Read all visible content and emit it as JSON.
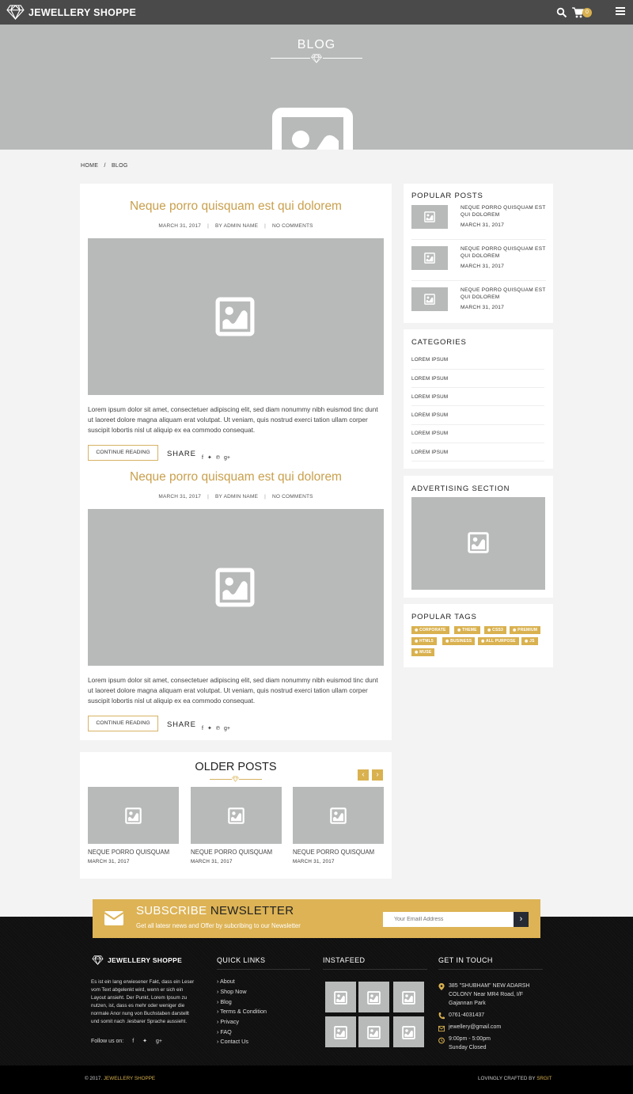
{
  "header": {
    "brand": "JEWELLERY SHOPPE",
    "cart_count": "0",
    "icons": [
      "diamond-icon",
      "search-icon",
      "cart-icon",
      "menu-icon"
    ]
  },
  "hero": {
    "title": "BLOG"
  },
  "breadcrumb": {
    "home": "HOME",
    "sep": "/",
    "current": "BLOG"
  },
  "posts": [
    {
      "title": "Neque porro quisquam est qui dolorem",
      "date": "MARCH 31, 2017",
      "author": "BY ADMIN NAME",
      "comments": "NO COMMENTS",
      "excerpt": "Lorem ipsum dolor sit amet, consectetuer adipiscing elit, sed diam nonummy nibh euismod tinc dunt ut laoreet dolore magna aliquam erat volutpat. Ut veniam, quis nostrud exerci tation ullam corper suscipit lobortis nisl ut aliquip ex ea commodo consequat.",
      "button": "CONTINUE READING",
      "share": "SHARE"
    },
    {
      "title": "Neque porro quisquam est qui dolorem",
      "date": "MARCH 31, 2017",
      "author": "BY ADMIN NAME",
      "comments": "NO COMMENTS",
      "excerpt": "Lorem ipsum dolor sit amet, consectetuer adipiscing elit, sed diam nonummy nibh euismod tinc dunt ut laoreet dolore magna aliquam erat volutpat. Ut veniam, quis nostrud exerci tation ullam corper suscipit lobortis nisl ut aliquip ex ea commodo consequat.",
      "button": "CONTINUE READING",
      "share": "SHARE"
    }
  ],
  "share_icons": {
    "facebook": "f",
    "twitter": "✦",
    "pinterest": "℗",
    "gplus": "g+"
  },
  "older": {
    "title": "OLDER POSTS",
    "prev": "‹",
    "next": "›",
    "items": [
      {
        "name": "NEQUE PORRO QUISQUAM",
        "date": "MARCH 31, 2017"
      },
      {
        "name": "NEQUE PORRO QUISQUAM",
        "date": "MARCH 31, 2017"
      },
      {
        "name": "NEQUE PORRO QUISQUAM",
        "date": "MARCH 31, 2017"
      }
    ]
  },
  "sidebar": {
    "popular_title": "POPULAR POSTS",
    "popular": [
      {
        "name": "NEQUE PORRO QUISQUAM EST QUI DOLOREM",
        "date": "MARCH 31, 2017"
      },
      {
        "name": "NEQUE PORRO QUISQUAM EST QUI DOLOREM",
        "date": "MARCH 31, 2017"
      },
      {
        "name": "NEQUE PORRO QUISQUAM EST QUI DOLOREM",
        "date": "MARCH 31, 2017"
      }
    ],
    "categories_title": "CATEGORIES",
    "categories": [
      "LOREM IPSUM",
      "LOREM IPSUM",
      "LOREM IPSUM",
      "LOREM IPSUM",
      "LOREM IPSUM",
      "LOREM IPSUM"
    ],
    "ad_title": "ADVERTISING SECTION",
    "tags_title": "POPULAR TAGS",
    "tags": [
      "CORPORATE",
      "THEME",
      "CSS3",
      "PREMIUM",
      "HTML5",
      "BUSINESS",
      "ALL PURPOSE",
      "JS",
      "MUSE"
    ]
  },
  "newsletter": {
    "title_a": "SUBSCRIBE ",
    "title_b": "NEWSLETTER",
    "text": "Get all latesr news and Offer by subcribing to our Newsletter",
    "placeholder": "Your Emaill Address",
    "button": "›"
  },
  "footer": {
    "brand": "JEWELLERY SHOPPE",
    "about": "Es ist ein lang erwiesener Fakt, dass ein Leser vom Text abgelenkt wird, wenn er sich ein Layout ansieht. Der Punkt, Lorem Ipsum zu nutzen, ist, dass es mehr oder weniger die normale Anor nung von Buchstaben darstellt und somit nach .lesbarer Sprache aussieht.",
    "follow": "Follow us on:",
    "follow_icons": [
      "f",
      "✦",
      "g+"
    ],
    "quick_title": "QUICK LINKS",
    "links": [
      "About",
      "Shop Now",
      "Blog",
      "Terms & Condition",
      "Privacy",
      "FAQ",
      "Contact Us"
    ],
    "insta_title": "INSTAFEED",
    "contact_title": "GET IN TOUCH",
    "address": [
      "385 \"SHUBHAM\" NEW ADARSH",
      "COLONY Near MR4 Road, I/F",
      "Gajannan Park"
    ],
    "phone": "0761-4031437",
    "email": "jewellery@gmail.com",
    "hours": "9:00pm - 5:00pm",
    "closed": "Sunday Closed",
    "copy_prefix": "© 2017. ",
    "copy_brand": "JEWELLERY SHOPPE",
    "credit_prefix": "LOVINGLY CRAFTED BY ",
    "credit_brand": "SRGIT"
  },
  "colors": {
    "accent": "#d9b14f",
    "topbar": "#4a4a4a",
    "placeholder": "#b8b9b9",
    "title_gold": "#c9a04d"
  }
}
